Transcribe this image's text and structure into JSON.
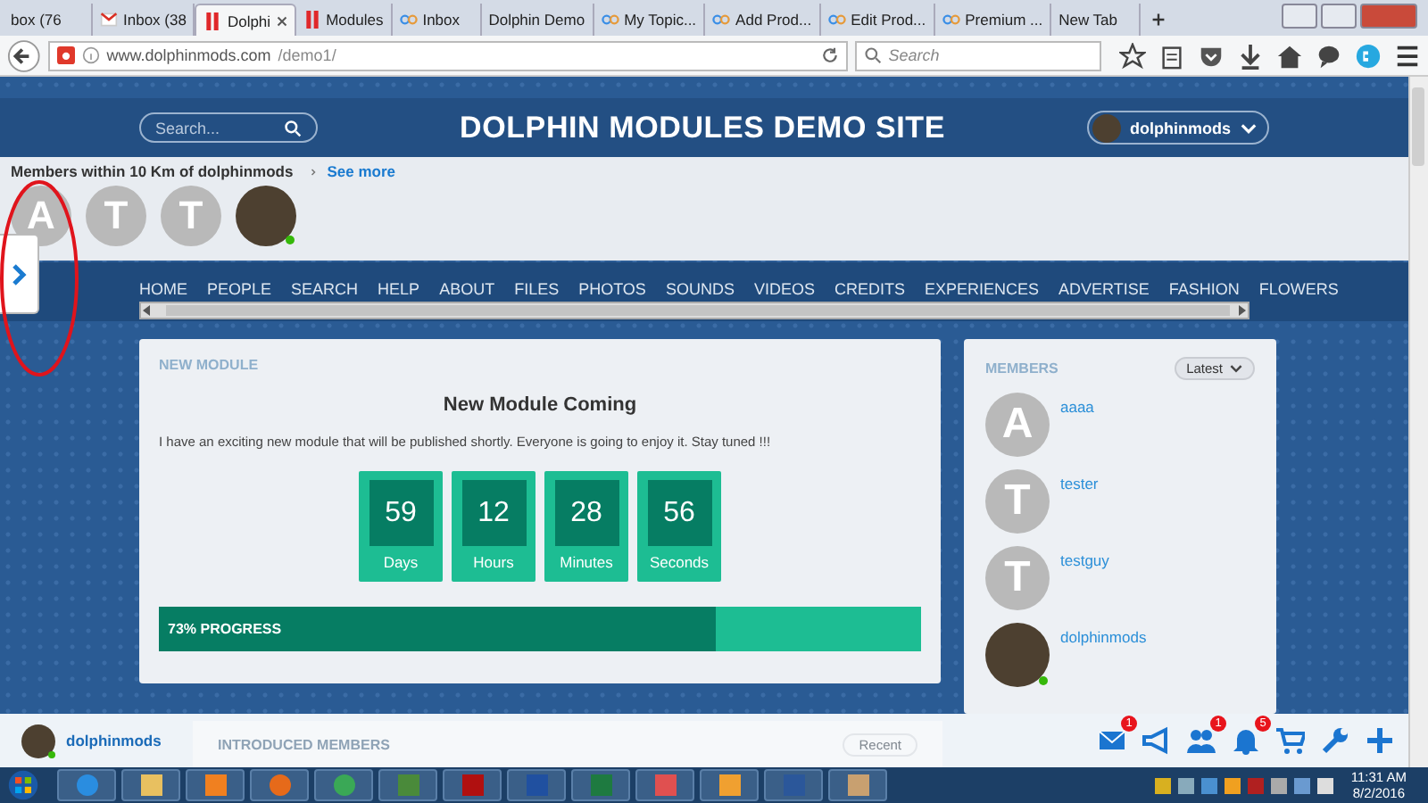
{
  "browser": {
    "tabs": [
      {
        "label": "box (76",
        "kind": "plain",
        "selected": false
      },
      {
        "label": "Inbox (38",
        "kind": "mail",
        "selected": false
      },
      {
        "label": "Dolphi",
        "kind": "bars",
        "selected": true
      },
      {
        "label": "Modules",
        "kind": "bars",
        "selected": false
      },
      {
        "label": "Inbox",
        "kind": "loop",
        "selected": false
      },
      {
        "label": "Dolphin Demo",
        "kind": "plain",
        "selected": false
      },
      {
        "label": "My Topic...",
        "kind": "loop",
        "selected": false
      },
      {
        "label": "Add Prod...",
        "kind": "loop",
        "selected": false
      },
      {
        "label": "Edit Prod...",
        "kind": "loop",
        "selected": false
      },
      {
        "label": "Premium ...",
        "kind": "loop",
        "selected": false
      },
      {
        "label": "New Tab",
        "kind": "plain",
        "selected": false
      }
    ],
    "url_host": "www.dolphinmods.com",
    "url_path": "/demo1/",
    "search_placeholder": "Search"
  },
  "header": {
    "search_placeholder": "Search...",
    "title": "DOLPHIN MODULES DEMO SITE",
    "user": "dolphinmods"
  },
  "nearby": {
    "title": "Members within 10 Km of dolphinmods",
    "link": "See more",
    "members": [
      {
        "kind": "letter",
        "letter": "A",
        "online": false
      },
      {
        "kind": "letter",
        "letter": "T",
        "online": false
      },
      {
        "kind": "letter",
        "letter": "T",
        "online": false
      },
      {
        "kind": "photo",
        "online": true
      }
    ]
  },
  "menu": [
    "HOME",
    "PEOPLE",
    "SEARCH",
    "HELP",
    "ABOUT",
    "FILES",
    "PHOTOS",
    "SOUNDS",
    "VIDEOS",
    "CREDITS",
    "EXPERIENCES",
    "ADVERTISE",
    "FASHION",
    "FLOWERS"
  ],
  "new_module": {
    "heading": "NEW MODULE",
    "title": "New Module Coming",
    "text": "I have an exciting new module that will be published shortly. Everyone is going to enjoy it. Stay tuned !!!",
    "countdown": [
      {
        "value": "59",
        "label": "Days"
      },
      {
        "value": "12",
        "label": "Hours"
      },
      {
        "value": "28",
        "label": "Minutes"
      },
      {
        "value": "56",
        "label": "Seconds"
      }
    ],
    "progress": {
      "label": "73% PROGRESS",
      "level": 0.73
    }
  },
  "members": {
    "heading": "MEMBERS",
    "sort": "Latest",
    "items": [
      {
        "name": "aaaa",
        "kind": "letter",
        "letter": "A",
        "online": false
      },
      {
        "name": "tester",
        "kind": "letter",
        "letter": "T",
        "online": false
      },
      {
        "name": "testguy",
        "kind": "letter",
        "letter": "T",
        "online": false
      },
      {
        "name": "dolphinmods",
        "kind": "photo",
        "online": true
      }
    ]
  },
  "introduced": {
    "heading": "INTRODUCED MEMBERS",
    "sort": "Recent"
  },
  "bottom_bar": {
    "user": "dolphinmods",
    "icons": [
      {
        "kind": "mail",
        "badge": "1"
      },
      {
        "kind": "megaphone"
      },
      {
        "kind": "people",
        "badge": "1"
      },
      {
        "kind": "bell",
        "badge": "5"
      },
      {
        "kind": "cart"
      },
      {
        "kind": "wrench"
      },
      {
        "kind": "plus"
      }
    ]
  },
  "taskbar": {
    "time": "11:31 AM",
    "date": "8/2/2016"
  }
}
